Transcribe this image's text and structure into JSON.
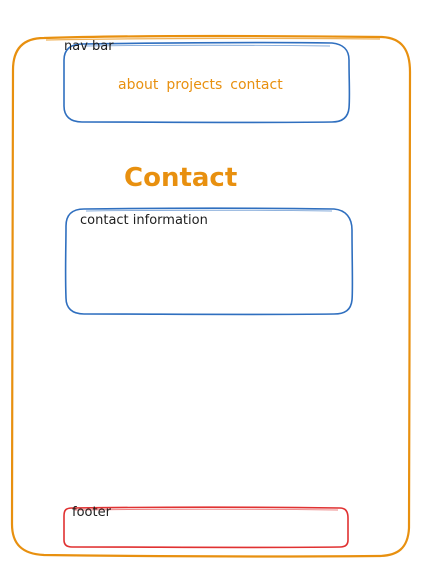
{
  "nav": {
    "label": "nav bar",
    "links": [
      "about",
      "projects",
      "contact"
    ]
  },
  "page": {
    "title": "Contact"
  },
  "contact": {
    "label": "contact information"
  },
  "footer": {
    "label": "footer"
  },
  "colors": {
    "page_frame": "#e8900f",
    "title_text": "#e8900f",
    "nav_box": "#2f6fbf",
    "contact_box": "#2f6fbf",
    "footer_box": "#e03131",
    "label_text": "#1e1e1e"
  }
}
